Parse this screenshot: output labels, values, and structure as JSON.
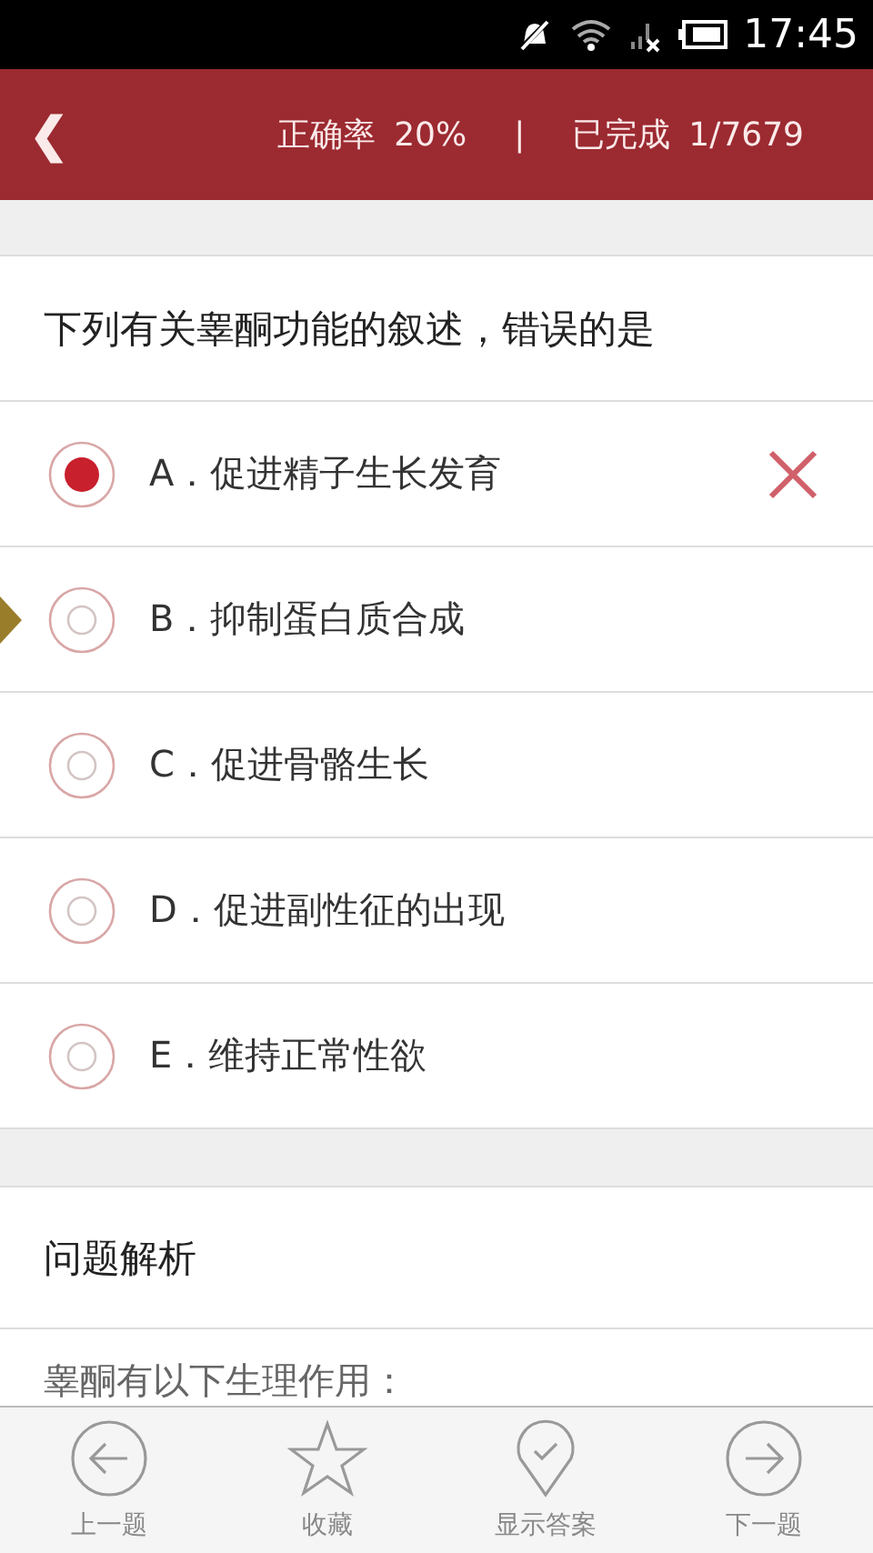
{
  "status_bar": {
    "time": "17:45"
  },
  "header": {
    "back": "❮",
    "accuracy_label": "正确率",
    "accuracy": "20%",
    "separator": "|",
    "done_label": "已完成",
    "progress": "1/7679"
  },
  "question": "下列有关睾酮功能的叙述，错误的是",
  "options": [
    {
      "text": "A．促进精子生长发育",
      "selected": true,
      "wrong": true,
      "pointed": false
    },
    {
      "text": "B．抑制蛋白质合成",
      "selected": false,
      "wrong": false,
      "pointed": true
    },
    {
      "text": "C．促进骨骼生长",
      "selected": false,
      "wrong": false,
      "pointed": false
    },
    {
      "text": "D．促进副性征的出现",
      "selected": false,
      "wrong": false,
      "pointed": false
    },
    {
      "text": "E．维持正常性欲",
      "selected": false,
      "wrong": false,
      "pointed": false
    }
  ],
  "analysis": {
    "title": "问题解析",
    "text": "睾酮有以下生理作用："
  },
  "toolbar": [
    {
      "kind": "prev",
      "label": "上一题"
    },
    {
      "kind": "star",
      "label": "收藏"
    },
    {
      "kind": "answer",
      "label": "显示答案"
    },
    {
      "kind": "next",
      "label": "下一题"
    }
  ]
}
